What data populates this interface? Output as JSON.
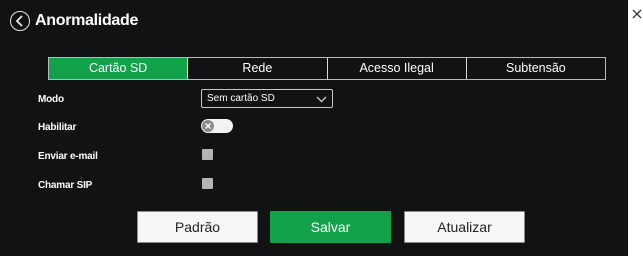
{
  "header": {
    "title": "Anormalidade"
  },
  "tabs": [
    {
      "label": "Cartão SD",
      "active": true
    },
    {
      "label": "Rede",
      "active": false
    },
    {
      "label": "Acesso Ilegal",
      "active": false
    },
    {
      "label": "Subtensão",
      "active": false
    }
  ],
  "form": {
    "mode_label": "Modo",
    "mode_value": "Sem cartão SD",
    "enable_label": "Habilitar",
    "enable_on": false,
    "email_label": "Enviar e-mail",
    "email_checked": false,
    "sip_label": "Chamar SIP",
    "sip_checked": false
  },
  "buttons": {
    "default_label": "Padrão",
    "save_label": "Salvar",
    "refresh_label": "Atualizar"
  },
  "colors": {
    "accent": "#12a24a",
    "panel": "#111214"
  }
}
